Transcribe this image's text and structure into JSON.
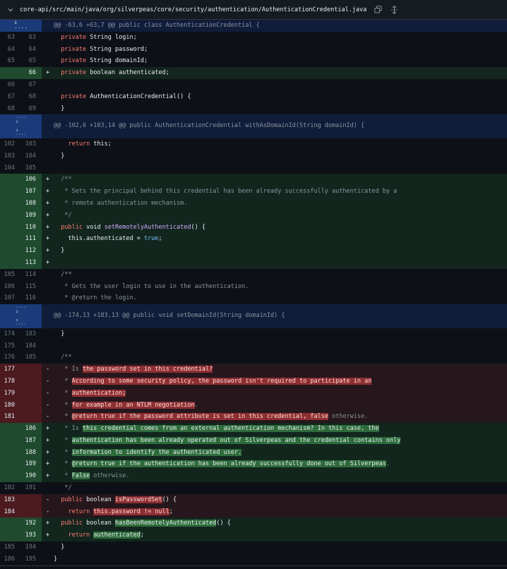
{
  "file": {
    "path": "core-api/src/main/java/org/silverpeas/core/security/authentication/AuthenticationCredential.java"
  },
  "icons": {
    "collapse": "chevron-down-icon",
    "copy": "copy-icon",
    "expand": "unfold-icon"
  },
  "hunks": [
    "@@ -63,6 +63,7 @@ public class AuthenticationCredential {",
    "@@ -102,6 +103,14 @@ public AuthenticationCredential withAsDomainId(String domainId) {",
    "@@ -174,13 +183,13 @@ public void setDomainId(String domainId) {"
  ],
  "lines": [
    {
      "t": "ctx",
      "o": "63",
      "n": "63",
      "s": "",
      "c": [
        [
          "  ",
          ""
        ],
        [
          "private",
          "kw"
        ],
        [
          " String login;",
          ""
        ]
      ]
    },
    {
      "t": "ctx",
      "o": "64",
      "n": "64",
      "s": "",
      "c": [
        [
          "  ",
          ""
        ],
        [
          "private",
          "kw"
        ],
        [
          " String password;",
          ""
        ]
      ]
    },
    {
      "t": "ctx",
      "o": "65",
      "n": "65",
      "s": "",
      "c": [
        [
          "  ",
          ""
        ],
        [
          "private",
          "kw"
        ],
        [
          " String domainId;",
          ""
        ]
      ]
    },
    {
      "t": "add",
      "o": "",
      "n": "66",
      "s": "+",
      "c": [
        [
          "  ",
          ""
        ],
        [
          "private",
          "kw"
        ],
        [
          " boolean authenticated;",
          ""
        ]
      ]
    },
    {
      "t": "ctx",
      "o": "66",
      "n": "67",
      "s": "",
      "c": []
    },
    {
      "t": "ctx",
      "o": "67",
      "n": "68",
      "s": "",
      "c": [
        [
          "  ",
          ""
        ],
        [
          "private",
          "kw"
        ],
        [
          " AuthenticationCredential() {",
          ""
        ]
      ]
    },
    {
      "t": "ctx",
      "o": "68",
      "n": "69",
      "s": "",
      "c": [
        [
          "  }",
          ""
        ]
      ]
    },
    {
      "t": "hunk",
      "h": 1
    },
    {
      "t": "ctx",
      "o": "102",
      "n": "103",
      "s": "",
      "c": [
        [
          "    ",
          ""
        ],
        [
          "return",
          "kw"
        ],
        [
          " this;",
          ""
        ]
      ]
    },
    {
      "t": "ctx",
      "o": "103",
      "n": "104",
      "s": "",
      "c": [
        [
          "  }",
          ""
        ]
      ]
    },
    {
      "t": "ctx",
      "o": "104",
      "n": "105",
      "s": "",
      "c": []
    },
    {
      "t": "add",
      "o": "",
      "n": "106",
      "s": "+",
      "c": [
        [
          "  /**",
          "cm"
        ]
      ]
    },
    {
      "t": "add",
      "o": "",
      "n": "107",
      "s": "+",
      "c": [
        [
          "   * Sets the principal behind this credential has been already successfully authenticated by a",
          "cm"
        ]
      ]
    },
    {
      "t": "add",
      "o": "",
      "n": "108",
      "s": "+",
      "c": [
        [
          "   * remote authentication mechanism.",
          "cm"
        ]
      ]
    },
    {
      "t": "add",
      "o": "",
      "n": "109",
      "s": "+",
      "c": [
        [
          "   */",
          "cm"
        ]
      ]
    },
    {
      "t": "add",
      "o": "",
      "n": "110",
      "s": "+",
      "c": [
        [
          "  ",
          ""
        ],
        [
          "public",
          "kw"
        ],
        [
          " void ",
          ""
        ],
        [
          "setRemotelyAuthenticated",
          "fn"
        ],
        [
          "() {",
          ""
        ]
      ]
    },
    {
      "t": "add",
      "o": "",
      "n": "111",
      "s": "+",
      "c": [
        [
          "    this.authenticated = ",
          ""
        ],
        [
          "true",
          "lit"
        ],
        [
          ";",
          ""
        ]
      ]
    },
    {
      "t": "add",
      "o": "",
      "n": "112",
      "s": "+",
      "c": [
        [
          "  }",
          ""
        ]
      ]
    },
    {
      "t": "add",
      "o": "",
      "n": "113",
      "s": "+",
      "c": []
    },
    {
      "t": "ctx",
      "o": "105",
      "n": "114",
      "s": "",
      "c": [
        [
          "  /**",
          "cm"
        ]
      ]
    },
    {
      "t": "ctx",
      "o": "106",
      "n": "115",
      "s": "",
      "c": [
        [
          "   * Gets the user login to use in the authentication.",
          "cm"
        ]
      ]
    },
    {
      "t": "ctx",
      "o": "107",
      "n": "116",
      "s": "",
      "c": [
        [
          "   * @return the login.",
          "cm"
        ]
      ]
    },
    {
      "t": "hunk",
      "h": 2
    },
    {
      "t": "ctx",
      "o": "174",
      "n": "183",
      "s": "",
      "c": [
        [
          "  }",
          ""
        ]
      ]
    },
    {
      "t": "ctx",
      "o": "175",
      "n": "184",
      "s": "",
      "c": []
    },
    {
      "t": "ctx",
      "o": "176",
      "n": "185",
      "s": "",
      "c": [
        [
          "  /**",
          "cm"
        ]
      ]
    },
    {
      "t": "del",
      "o": "177",
      "n": "",
      "s": "-",
      "c": [
        [
          "   * Is ",
          "cm"
        ],
        [
          "the password set in this credential?",
          "hl-del"
        ]
      ]
    },
    {
      "t": "del",
      "o": "178",
      "n": "",
      "s": "-",
      "c": [
        [
          "   * ",
          "cm"
        ],
        [
          "According to some security policy, the password isn't required to participate in an",
          "hl-del"
        ]
      ]
    },
    {
      "t": "del",
      "o": "179",
      "n": "",
      "s": "-",
      "c": [
        [
          "   * ",
          "cm"
        ],
        [
          "authentication;",
          "hl-del"
        ]
      ]
    },
    {
      "t": "del",
      "o": "180",
      "n": "",
      "s": "-",
      "c": [
        [
          "   * ",
          "cm"
        ],
        [
          "for example in an NTLM negotiation",
          "hl-del"
        ],
        [
          ".",
          "cm"
        ]
      ]
    },
    {
      "t": "del",
      "o": "181",
      "n": "",
      "s": "-",
      "c": [
        [
          "   * ",
          "cm"
        ],
        [
          "@return true if the password attribute is set in this credential, false",
          "hl-del"
        ],
        [
          " otherwise.",
          "cm"
        ]
      ]
    },
    {
      "t": "add",
      "o": "",
      "n": "186",
      "s": "+",
      "c": [
        [
          "   * Is ",
          "cm"
        ],
        [
          "this credential comes from an external authentication mechanism? In this case, the",
          "hl-add"
        ]
      ]
    },
    {
      "t": "add",
      "o": "",
      "n": "187",
      "s": "+",
      "c": [
        [
          "   * ",
          "cm"
        ],
        [
          "authentication has been already operated out of Silverpeas and the credential contains only",
          "hl-add"
        ]
      ]
    },
    {
      "t": "add",
      "o": "",
      "n": "188",
      "s": "+",
      "c": [
        [
          "   * ",
          "cm"
        ],
        [
          "information to identify the authenticated user.",
          "hl-add"
        ]
      ]
    },
    {
      "t": "add",
      "o": "",
      "n": "189",
      "s": "+",
      "c": [
        [
          "   * ",
          "cm"
        ],
        [
          "@return true if the authentication has been already successfully done out of Silverpeas",
          "hl-add"
        ],
        [
          ".",
          "cm"
        ]
      ]
    },
    {
      "t": "add",
      "o": "",
      "n": "190",
      "s": "+",
      "c": [
        [
          "   * ",
          "cm"
        ],
        [
          "False",
          "hl-add"
        ],
        [
          " otherwise.",
          "cm"
        ]
      ]
    },
    {
      "t": "ctx",
      "o": "182",
      "n": "191",
      "s": "",
      "c": [
        [
          "   */",
          "cm"
        ]
      ]
    },
    {
      "t": "del",
      "o": "183",
      "n": "",
      "s": "-",
      "c": [
        [
          "  ",
          ""
        ],
        [
          "public",
          "kw"
        ],
        [
          " boolean ",
          ""
        ],
        [
          "isPasswordSet",
          "hl-del"
        ],
        [
          "() {",
          ""
        ]
      ]
    },
    {
      "t": "del",
      "o": "184",
      "n": "",
      "s": "-",
      "c": [
        [
          "    ",
          ""
        ],
        [
          "return",
          "kw"
        ],
        [
          " ",
          ""
        ],
        [
          "this.password != null",
          "hl-del"
        ],
        [
          ";",
          ""
        ]
      ]
    },
    {
      "t": "add",
      "o": "",
      "n": "192",
      "s": "+",
      "c": [
        [
          "  ",
          ""
        ],
        [
          "public",
          "kw"
        ],
        [
          " boolean ",
          ""
        ],
        [
          "hasBeenRemotelyAuthenticated",
          "hl-add"
        ],
        [
          "() {",
          ""
        ]
      ]
    },
    {
      "t": "add",
      "o": "",
      "n": "193",
      "s": "+",
      "c": [
        [
          "    ",
          ""
        ],
        [
          "return",
          "kw"
        ],
        [
          " ",
          ""
        ],
        [
          "authenticated",
          "hl-add"
        ],
        [
          ";",
          ""
        ]
      ]
    },
    {
      "t": "ctx",
      "o": "185",
      "n": "194",
      "s": "",
      "c": [
        [
          "  }",
          ""
        ]
      ]
    },
    {
      "t": "ctx",
      "o": "186",
      "n": "195",
      "s": "",
      "c": [
        [
          "}",
          ""
        ]
      ]
    }
  ]
}
